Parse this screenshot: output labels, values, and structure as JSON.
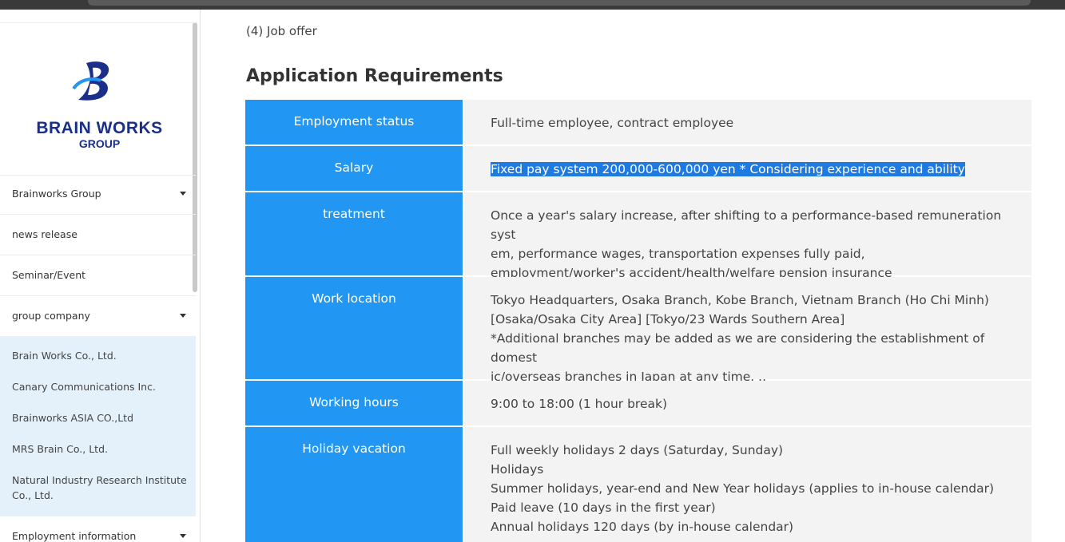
{
  "sidebar": {
    "logo_line1": "BRAIN WORKS",
    "logo_line2": "GROUP",
    "items": [
      {
        "label": "Brainworks Group",
        "has_caret": true
      },
      {
        "label": "news release",
        "has_caret": false
      },
      {
        "label": "Seminar/Event",
        "has_caret": false
      },
      {
        "label": "group company",
        "has_caret": true
      },
      {
        "label": "Employment information",
        "has_caret": true
      }
    ],
    "subitems": [
      "Brain Works Co., Ltd.",
      "Canary Communications Inc.",
      "Brainworks ASIA CO.,Ltd",
      "MRS Brain Co., Ltd.",
      "Natural Industry Research Institute Co., Ltd."
    ]
  },
  "main": {
    "crumb": "(4) Job offer",
    "heading": "Application Requirements",
    "rows": [
      {
        "label": "Employment status",
        "lines": [
          "Full-time employee, contract employee"
        ]
      },
      {
        "label": "Salary",
        "lines": [
          "Fixed pay system 200,000-600,000 yen * Considering experience and ability"
        ],
        "selected": true
      },
      {
        "label": "treatment",
        "lines": [
          "Once a year's salary increase, after shifting to a performance-based remuneration syst",
          "em, performance wages, transportation expenses fully paid,",
          "employment/worker's accident/health/welfare pension insurance"
        ]
      },
      {
        "label": "Work location",
        "lines": [
          "Tokyo Headquarters, Osaka Branch, Kobe Branch, Vietnam Branch (Ho Chi Minh)",
          "[Osaka/Osaka City Area] [Tokyo/23 Wards Southern Area]",
          "*Additional branches may be added as we are considering the establishment of domest",
          "ic/overseas branches in Japan at any time. .."
        ]
      },
      {
        "label": "Working hours",
        "lines": [
          "9:00 to 18:00 (1 hour break)"
        ]
      },
      {
        "label": "Holiday vacation",
        "lines": [
          "Full weekly holidays 2 days (Saturday, Sunday)",
          "Holidays",
          "Summer holidays, year-end and New Year holidays (applies to in-house calendar)",
          "Paid leave (10 days in the first year)",
          "Annual holidays 120 days (by in-house calendar)"
        ]
      }
    ]
  },
  "colors": {
    "header_cell": "#2196f3",
    "value_cell": "#f3f3f3",
    "selection": "#1e7ae0",
    "logo": "#1a2f8a",
    "submenu_bg": "#e4f1fb"
  }
}
